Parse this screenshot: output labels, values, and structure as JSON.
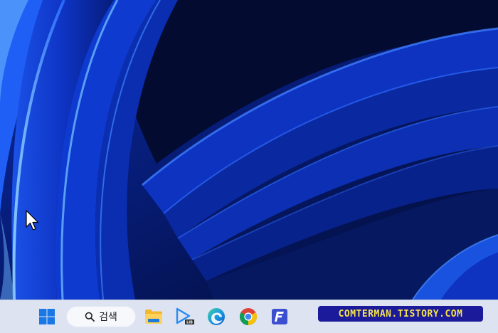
{
  "desktop": {
    "wallpaper": "Windows 11 Bloom (blue)",
    "colors": {
      "deep": "#040d35",
      "mid": "#0b2fb0",
      "bright": "#2a6bff",
      "glow": "#7fc4ff"
    }
  },
  "taskbar": {
    "background": "#dde3f1",
    "search": {
      "label": "검색",
      "icon": "search-icon"
    },
    "apps": [
      {
        "name": "start",
        "icon": "windows-logo-icon"
      },
      {
        "name": "file-explorer",
        "icon": "folder-icon"
      },
      {
        "name": "media-player",
        "icon": "play-icon"
      },
      {
        "name": "edge",
        "icon": "edge-icon"
      },
      {
        "name": "chrome",
        "icon": "chrome-icon"
      },
      {
        "name": "f-app",
        "icon": "f-app-icon"
      }
    ]
  },
  "watermark": {
    "text": "COMTERMAN.TISTORY.COM"
  }
}
